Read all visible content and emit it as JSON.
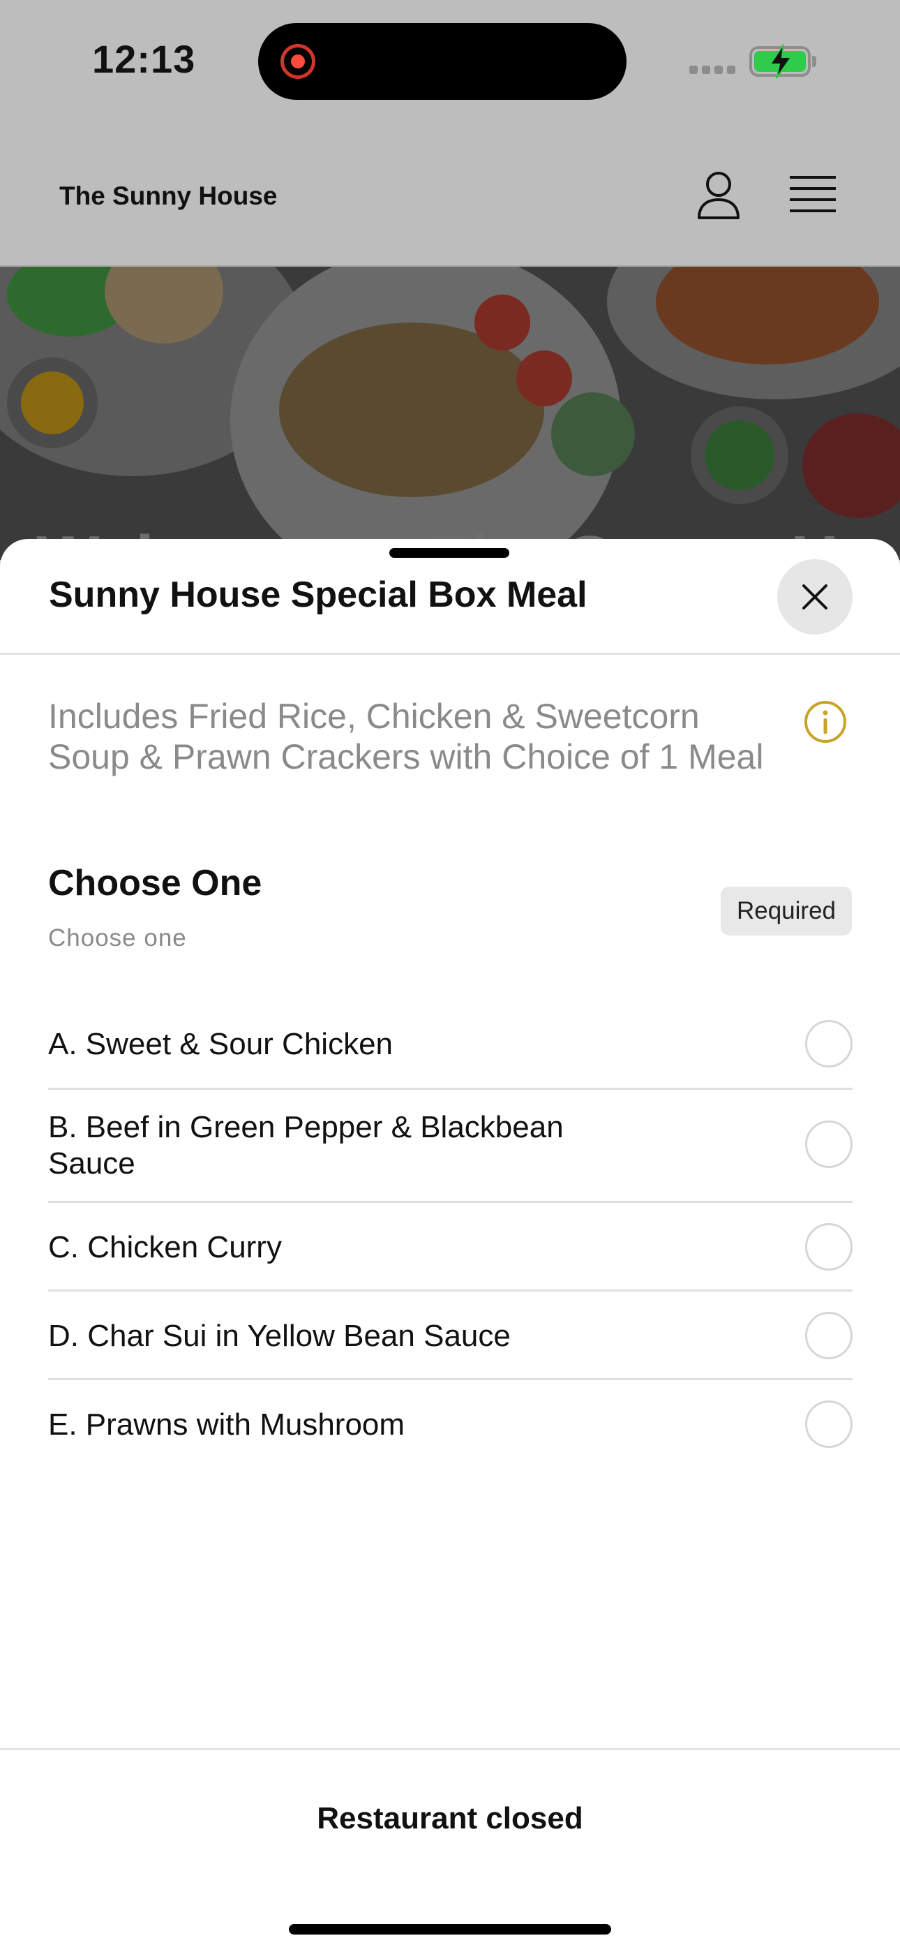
{
  "status_bar": {
    "time": "12:13"
  },
  "header": {
    "brand": "The Sunny House",
    "account_icon": "user-icon",
    "menu_icon": "hamburger-menu-icon"
  },
  "hero": {
    "welcome_text": "Welcome to The Sunny House"
  },
  "sheet": {
    "title": "Sunny House Special Box Meal",
    "description": "Includes Fried Rice, Chicken & Sweetcorn Soup & Prawn Crackers with Choice of 1 Meal",
    "info_icon": "info-icon",
    "info_icon_color": "#c9a227",
    "group": {
      "title": "Choose One",
      "subtitle": "Choose one",
      "badge": "Required",
      "options": [
        {
          "label": "A. Sweet & Sour Chicken"
        },
        {
          "label": "B. Beef in Green Pepper & Blackbean Sauce"
        },
        {
          "label": "C. Chicken Curry"
        },
        {
          "label": "D. Char Sui in Yellow Bean Sauce"
        },
        {
          "label": "E. Prawns with Mushroom"
        }
      ]
    }
  },
  "footer": {
    "status": "Restaurant closed"
  }
}
